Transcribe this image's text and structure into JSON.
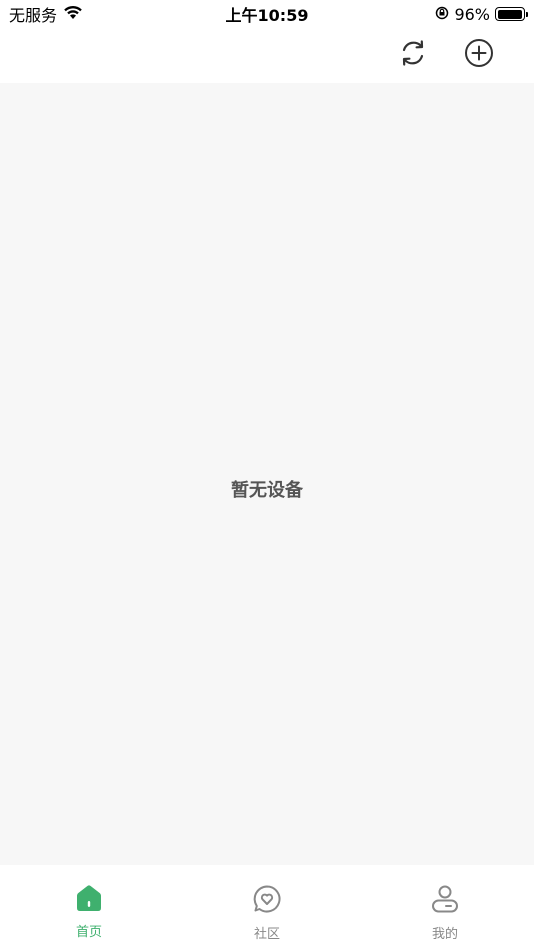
{
  "status_bar": {
    "carrier": "无服务",
    "time": "上午10:59",
    "battery_percent": "96%",
    "battery_level": 0.96
  },
  "nav": {
    "refresh_icon": "refresh-icon",
    "add_icon": "plus-circle-icon"
  },
  "main": {
    "empty_message": "暂无设备"
  },
  "tabs": [
    {
      "label": "首页",
      "icon": "home-icon",
      "active": true
    },
    {
      "label": "社区",
      "icon": "heart-bubble-icon",
      "active": false
    },
    {
      "label": "我的",
      "icon": "user-icon",
      "active": false
    }
  ],
  "colors": {
    "accent": "#3fb06e",
    "inactive": "#888888",
    "content_bg": "#f7f7f7"
  }
}
